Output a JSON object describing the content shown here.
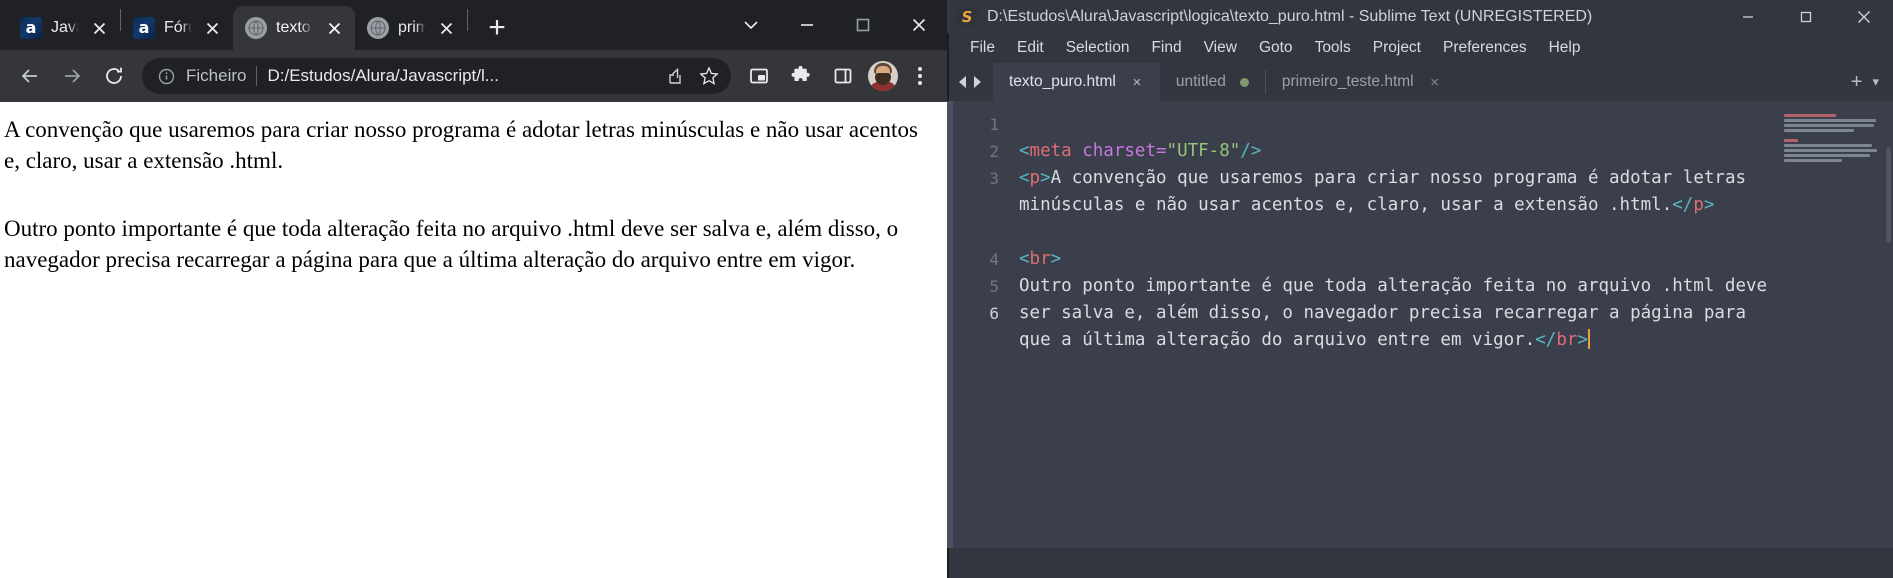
{
  "browser": {
    "tabs": [
      {
        "title": "Javas",
        "favicon": "alura-icon",
        "active": false
      },
      {
        "title": "Fórur",
        "favicon": "alura-icon",
        "active": false
      },
      {
        "title": "texto",
        "favicon": "globe-icon",
        "active": true
      },
      {
        "title": "prim",
        "favicon": "globe-icon",
        "active": false
      }
    ],
    "new_tab_label": "+",
    "window_controls": {
      "tab_search": "tab-search-icon",
      "minimize": "minimize-icon",
      "maximize": "maximize-icon",
      "close": "close-icon"
    },
    "toolbar": {
      "back": "back-arrow-icon",
      "forward": "forward-arrow-icon",
      "reload": "reload-icon",
      "scheme_label": "Ficheiro",
      "url": "D:/Estudos/Alura/Javascript/l...",
      "share": "share-icon",
      "bookmark": "star-icon",
      "picture_in_picture": "picture-in-picture-icon",
      "extensions": "puzzle-icon",
      "side_panel": "side-panel-icon",
      "profile": "avatar",
      "menu": "kebab-menu-icon"
    },
    "page": {
      "paragraph_1": "A convenção que usaremos para criar nosso programa é adotar letras minúsculas e não usar acentos e, claro, usar a extensão .html.",
      "paragraph_2": "Outro ponto importante é que toda alteração feita no arquivo .html deve ser salva e, além disso, o navegador precisa recarregar a página para que a última alteração do arquivo entre em vigor."
    }
  },
  "sublime": {
    "title": "D:\\Estudos\\Alura\\Javascript\\logica\\texto_puro.html - Sublime Text (UNREGISTERED)",
    "logo": "sublime-logo-icon",
    "window_controls": {
      "minimize": "minimize-icon",
      "maximize": "maximize-icon",
      "close": "close-icon"
    },
    "menu": [
      "File",
      "Edit",
      "Selection",
      "Find",
      "View",
      "Goto",
      "Tools",
      "Project",
      "Preferences",
      "Help"
    ],
    "tabs": [
      {
        "label": "texto_puro.html",
        "active": true,
        "modified": false,
        "close": "×"
      },
      {
        "label": "untitled",
        "active": false,
        "modified": true,
        "close": ""
      },
      {
        "label": "primeiro_teste.html",
        "active": false,
        "modified": false,
        "close": "×"
      }
    ],
    "tab_actions": {
      "new_tab": "+",
      "tab_list": "▾"
    },
    "nav_arrows": {
      "prev": "prev-tab-icon",
      "next": "next-tab-icon"
    },
    "gutter_lines": [
      "1",
      "2",
      "3",
      "4",
      "5",
      "6"
    ],
    "current_line": 6,
    "code": {
      "line2_tag_open": "<meta",
      "line2_attr": " charset=",
      "line2_value": "\"UTF-8\"",
      "line2_tag_close": "/>",
      "line3_p_open": "<p>",
      "line3_text": "A convenção que usaremos para criar nosso programa é adotar letras minúsculas e não usar acentos e, claro, usar a extensão .html.",
      "line3_p_close": "</p>",
      "line5_br": "<br>",
      "line6_text": "Outro ponto importante é que toda alteração feita no arquivo .html deve ser salva e, além disso, o navegador precisa recarregar a página para que a última alteração do arquivo entre em vigor.",
      "line6_br_close": "</br>"
    }
  },
  "colors": {
    "browser_chrome": "#202124",
    "browser_toolbar": "#35363a",
    "sublime_chrome": "#32363e",
    "sublime_editor": "#3a3f4b",
    "tag_red": "#e06c75",
    "punc_cyan": "#56b6c2",
    "attr_purple": "#c678dd",
    "string_green": "#98c379",
    "caret_orange": "#e5a33b",
    "modified_dot_green": "#7f9a6e",
    "sublime_logo_orange": "#e8a33d"
  }
}
